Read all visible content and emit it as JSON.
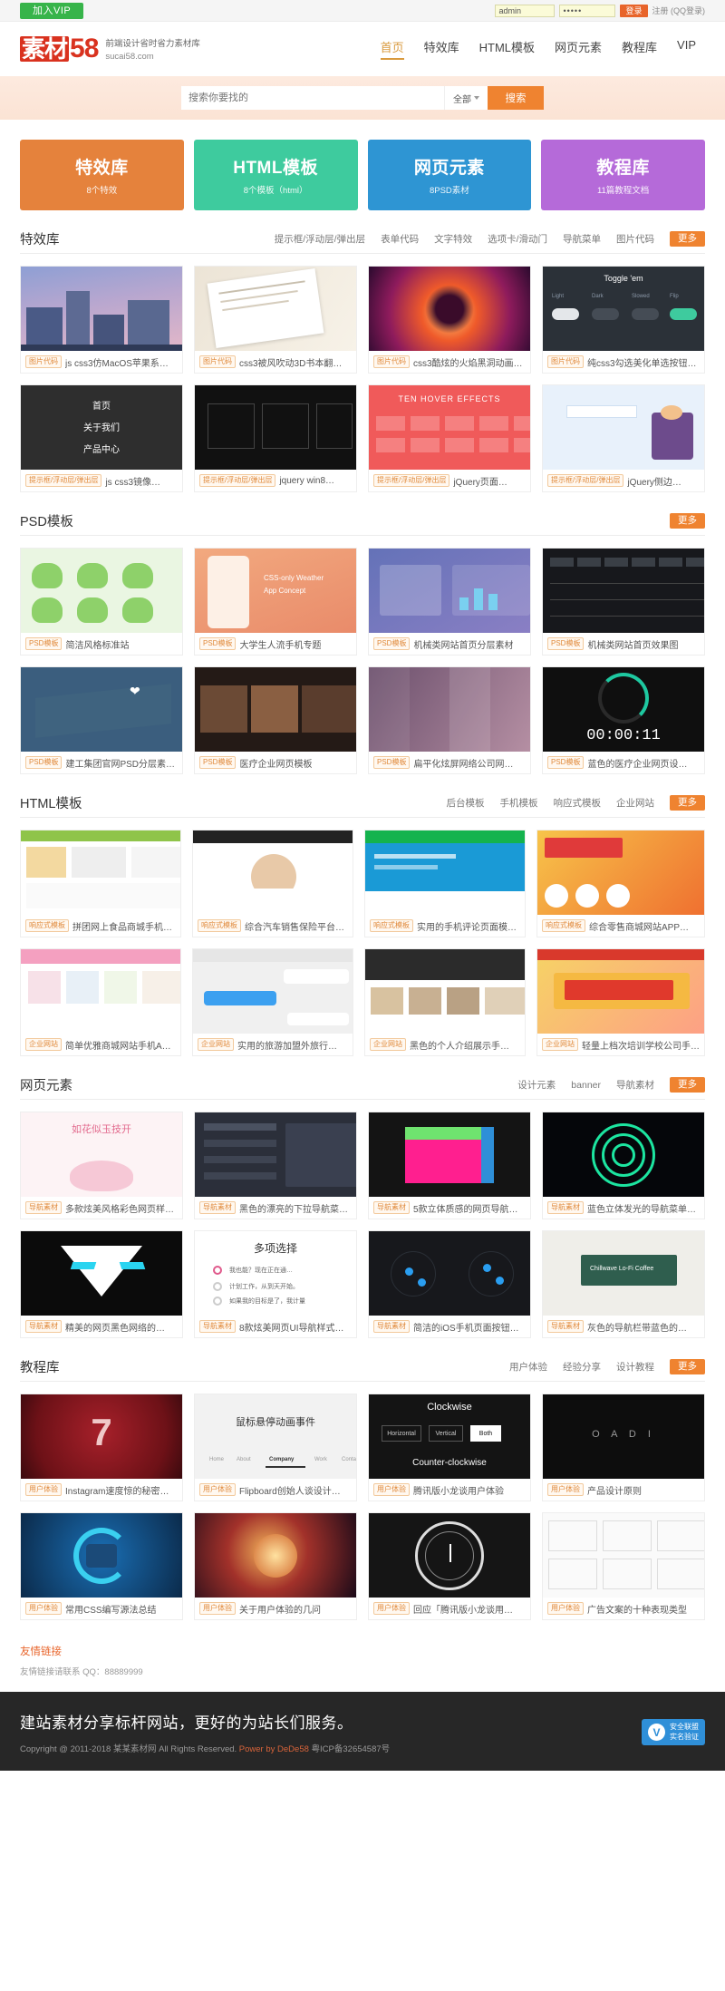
{
  "topbar": {
    "vip_label": "加入VIP",
    "username_value": "admin",
    "password_value": "•••••",
    "login_label": "登录",
    "register_text": "注册 (QQ登录)"
  },
  "header": {
    "logo_cn": "素材",
    "logo_num": "58",
    "tagline1": "前端设计省时省力素材库",
    "tagline2": "sucai58.com",
    "nav": [
      {
        "label": "首页",
        "active": true
      },
      {
        "label": "特效库",
        "active": false
      },
      {
        "label": "HTML模板",
        "active": false
      },
      {
        "label": "网页元素",
        "active": false
      },
      {
        "label": "教程库",
        "active": false
      },
      {
        "label": "VIP",
        "active": false
      }
    ]
  },
  "search": {
    "placeholder": "搜索你要找的",
    "category": "全部",
    "button": "搜索"
  },
  "cards": [
    {
      "title": "特效库",
      "sub": "8个特效",
      "color": "#e5823c"
    },
    {
      "title": "HTML模板",
      "sub": "8个模板（html）",
      "color": "#3ecb9e"
    },
    {
      "title": "网页元素",
      "sub": "8PSD素材",
      "color": "#2e95d3"
    },
    {
      "title": "教程库",
      "sub": "11篇教程文档",
      "color": "#b濃"
    }
  ],
  "sections": [
    {
      "title": "特效库",
      "links": [
        "提示框/浮动层/弹出层",
        "表单代码",
        "文字特效",
        "选项卡/滑动门",
        "导航菜单",
        "图片代码"
      ],
      "more": "更多",
      "items": [
        {
          "tag": "图片代码",
          "title": "js css3仿MacOS苹果系…",
          "art": "sky"
        },
        {
          "tag": "图片代码",
          "title": "css3被风吹动3D书本翻…",
          "art": "paper"
        },
        {
          "tag": "图片代码",
          "title": "css3酷炫的火焰黑洞动画…",
          "art": "fire"
        },
        {
          "tag": "图片代码",
          "title": "纯css3勾选美化单选按钮…",
          "art": "toggle"
        },
        {
          "tag": "提示框/浮动层/弹出层",
          "title": "js css3镜像…",
          "art": "dark"
        },
        {
          "tag": "提示框/浮动层/弹出层",
          "title": "jquery win8…",
          "art": "black"
        },
        {
          "tag": "提示框/浮动层/弹出层",
          "title": "jQuery页面…",
          "art": "red"
        },
        {
          "tag": "提示框/浮动层/弹出层",
          "title": "jQuery侧边…",
          "art": "lightblue"
        }
      ]
    },
    {
      "title": "PSD模板",
      "links": [],
      "more": "更多",
      "items": [
        {
          "tag": "PSD模板",
          "title": "简洁风格标准站",
          "art": "frog"
        },
        {
          "tag": "PSD模板",
          "title": "大学生人流手机专题",
          "art": "phone"
        },
        {
          "tag": "PSD模板",
          "title": "机械类网站首页分层素材",
          "art": "mech"
        },
        {
          "tag": "PSD模板",
          "title": "机械类网站首页效果图",
          "art": "mechb"
        },
        {
          "tag": "PSD模板",
          "title": "建工集团官网PSD分层素…",
          "art": "blue"
        },
        {
          "tag": "PSD模板",
          "title": "医疗企业网页模板",
          "art": "film"
        },
        {
          "tag": "PSD模板",
          "title": "扁平化炫屏网络公司网…",
          "art": "purple"
        },
        {
          "tag": "PSD模板",
          "title": "蓝色的医疗企业网页设…",
          "art": "timer",
          "overlay": "00:00:11"
        }
      ]
    },
    {
      "title": "HTML模板",
      "links": [
        "后台模板",
        "手机模板",
        "响应式模板",
        "企业网站"
      ],
      "more": "更多",
      "items": [
        {
          "tag": "响应式模板",
          "title": "拼团网上食品商城手机…",
          "art": "shop"
        },
        {
          "tag": "响应式模板",
          "title": "综合汽车销售保险平台…",
          "art": "person"
        },
        {
          "tag": "响应式模板",
          "title": "实用的手机评论页面模…",
          "art": "site"
        },
        {
          "tag": "响应式模板",
          "title": "综合零售商城网站APP…",
          "art": "promo"
        },
        {
          "tag": "企业网站",
          "title": "简单优雅商城网站手机A…",
          "art": "app"
        },
        {
          "tag": "企业网站",
          "title": "实用的旅游加盟外旅行…",
          "art": "chat"
        },
        {
          "tag": "企业网站",
          "title": "黑色的个人介绍展示手…",
          "art": "list"
        },
        {
          "tag": "企业网站",
          "title": "轻量上档次培训学校公司手…",
          "art": "promo2"
        }
      ]
    },
    {
      "title": "网页元素",
      "links": [
        "设计元素",
        "banner",
        "导航素材"
      ],
      "more": "更多",
      "items": [
        {
          "tag": "导航素材",
          "title": "多款炫美风格彩色网页样…",
          "art": "lotus"
        },
        {
          "tag": "导航素材",
          "title": "黑色的漂亮的下拉导航菜…",
          "art": "darkcard"
        },
        {
          "tag": "导航素材",
          "title": "5款立体质感的网页导航…",
          "art": "cube"
        },
        {
          "tag": "导航素材",
          "title": "蓝色立体发光的导航菜单…",
          "art": "neon"
        },
        {
          "tag": "导航素材",
          "title": "精美的网页黑色网络的…",
          "art": "robot"
        },
        {
          "tag": "导航素材",
          "title": "8款炫美网页UI导航样式…",
          "art": "choose"
        },
        {
          "tag": "导航素材",
          "title": "简洁的iOS手机页面按钮…",
          "art": "dots"
        },
        {
          "tag": "导航素材",
          "title": "灰色的导航栏带蓝色的…",
          "art": "coffee"
        }
      ]
    },
    {
      "title": "教程库",
      "links": [
        "用户体验",
        "经验分享",
        "设计教程"
      ],
      "more": "更多",
      "items": [
        {
          "tag": "用户体验",
          "title": "Instagram速度惊的秘密…",
          "art": "seven"
        },
        {
          "tag": "用户体验",
          "title": "Flipboard创始人谈设计…",
          "art": "flip"
        },
        {
          "tag": "用户体验",
          "title": "腾讯版小龙谈用户体验",
          "art": "clock"
        },
        {
          "tag": "用户体验",
          "title": "产品设计原则",
          "art": "oadi"
        },
        {
          "tag": "用户体验",
          "title": "常用CSS编写源法总结",
          "art": "ring"
        },
        {
          "tag": "用户体验",
          "title": "关于用户体验的几问",
          "art": "space"
        },
        {
          "tag": "用户体验",
          "title": "回应「腾讯版小龙谈用…",
          "art": "gauge"
        },
        {
          "tag": "用户体验",
          "title": "广告文案的十种表现类型",
          "art": "wire"
        }
      ]
    }
  ],
  "friend_links": {
    "title": "友情链接",
    "body": "友情链接请联系 QQ：88889999"
  },
  "footer": {
    "slogan": "建站素材分享标杆网站，更好的为站长们服务。",
    "copyright_pre": "Copyright @ 2011-2018 某某素材网 All Rights Reserved. ",
    "power": "Power by DeDe58",
    "icp": " 粤ICP备32654587号",
    "badge_mark": "V",
    "badge_line1": "安全联盟",
    "badge_line2": "实名验证"
  },
  "theme": {
    "orange": "#ef8330",
    "green": "#37b44a",
    "red": "#d9321f",
    "card_orange": "#e5823c",
    "card_teal": "#3ecb9e",
    "card_blue": "#2e95d3",
    "card_purple": "#b濃"
  }
}
